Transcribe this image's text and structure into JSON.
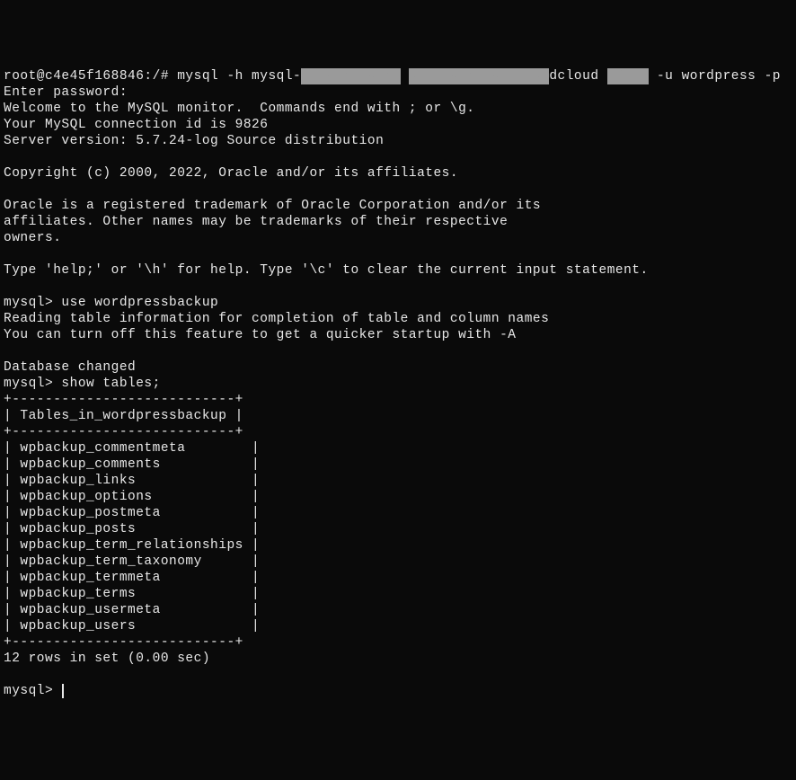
{
  "shell_prompt": "root@c4e45f168846:/#",
  "cmd_connect_part1": "mysql -h mysql-",
  "cmd_connect_redact1": "XXXXXX XXXXX",
  "cmd_connect_space1": " ",
  "cmd_connect_redact2": "XXXXXX XXXXX XXXX",
  "cmd_connect_part2": "dcloud",
  "cmd_connect_redact3": "XXXXX",
  "cmd_connect_part3": "-u wordpress -p",
  "enter_password": "Enter password:",
  "welcome": "Welcome to the MySQL monitor.  Commands end with ; or \\g.",
  "connection_id": "Your MySQL connection id is 9826",
  "server_version": "Server version: 5.7.24-log Source distribution",
  "copyright": "Copyright (c) 2000, 2022, Oracle and/or its affiliates.",
  "trademark1": "Oracle is a registered trademark of Oracle Corporation and/or its",
  "trademark2": "affiliates. Other names may be trademarks of their respective",
  "trademark3": "owners.",
  "help_text": "Type 'help;' or '\\h' for help. Type '\\c' to clear the current input statement.",
  "mysql_prompt": "mysql>",
  "cmd_use": "use wordpressbackup",
  "reading_info": "Reading table information for completion of table and column names",
  "turn_off": "You can turn off this feature to get a quicker startup with -A",
  "db_changed": "Database changed",
  "cmd_show": "show tables;",
  "border": "+---------------------------+",
  "header_row": "| Tables_in_wordpressbackup |",
  "tables": [
    "| wpbackup_commentmeta        |",
    "| wpbackup_comments           |",
    "| wpbackup_links              |",
    "| wpbackup_options            |",
    "| wpbackup_postmeta           |",
    "| wpbackup_posts              |",
    "| wpbackup_term_relationships |",
    "| wpbackup_term_taxonomy      |",
    "| wpbackup_termmeta           |",
    "| wpbackup_terms              |",
    "| wpbackup_usermeta           |",
    "| wpbackup_users              |"
  ],
  "result_count": "12 rows in set (0.00 sec)"
}
